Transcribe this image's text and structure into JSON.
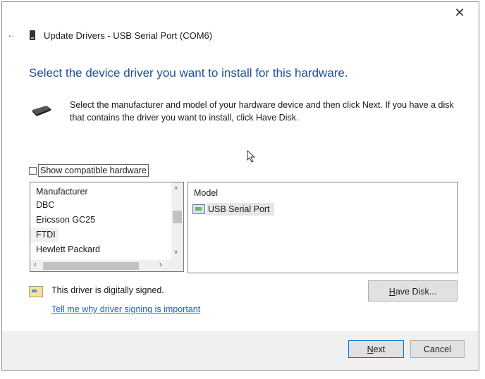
{
  "window": {
    "title": "Update Drivers - USB Serial Port (COM6)",
    "close_icon": "close-icon",
    "back_icon": "back-arrow-icon"
  },
  "heading": "Select the device driver you want to install for this hardware.",
  "description": "Select the manufacturer and model of your hardware device and then click Next. If you have a disk that contains the driver you want to install, click Have Disk.",
  "compatible": {
    "label": "Show compatible hardware",
    "checked": false
  },
  "manufacturer": {
    "header": "Manufacturer",
    "items": [
      "DBC",
      "Ericsson GC25",
      "FTDI",
      "Hewlett Packard"
    ],
    "selected": "FTDI"
  },
  "model": {
    "header": "Model",
    "items": [
      "USB Serial Port"
    ],
    "selected": "USB Serial Port"
  },
  "signing": {
    "text": "This driver is digitally signed.",
    "link": "Tell me why driver signing is important"
  },
  "buttons": {
    "have_disk_u": "H",
    "have_disk_rest": "ave Disk...",
    "next_u": "N",
    "next_rest": "ext",
    "cancel": "Cancel"
  }
}
